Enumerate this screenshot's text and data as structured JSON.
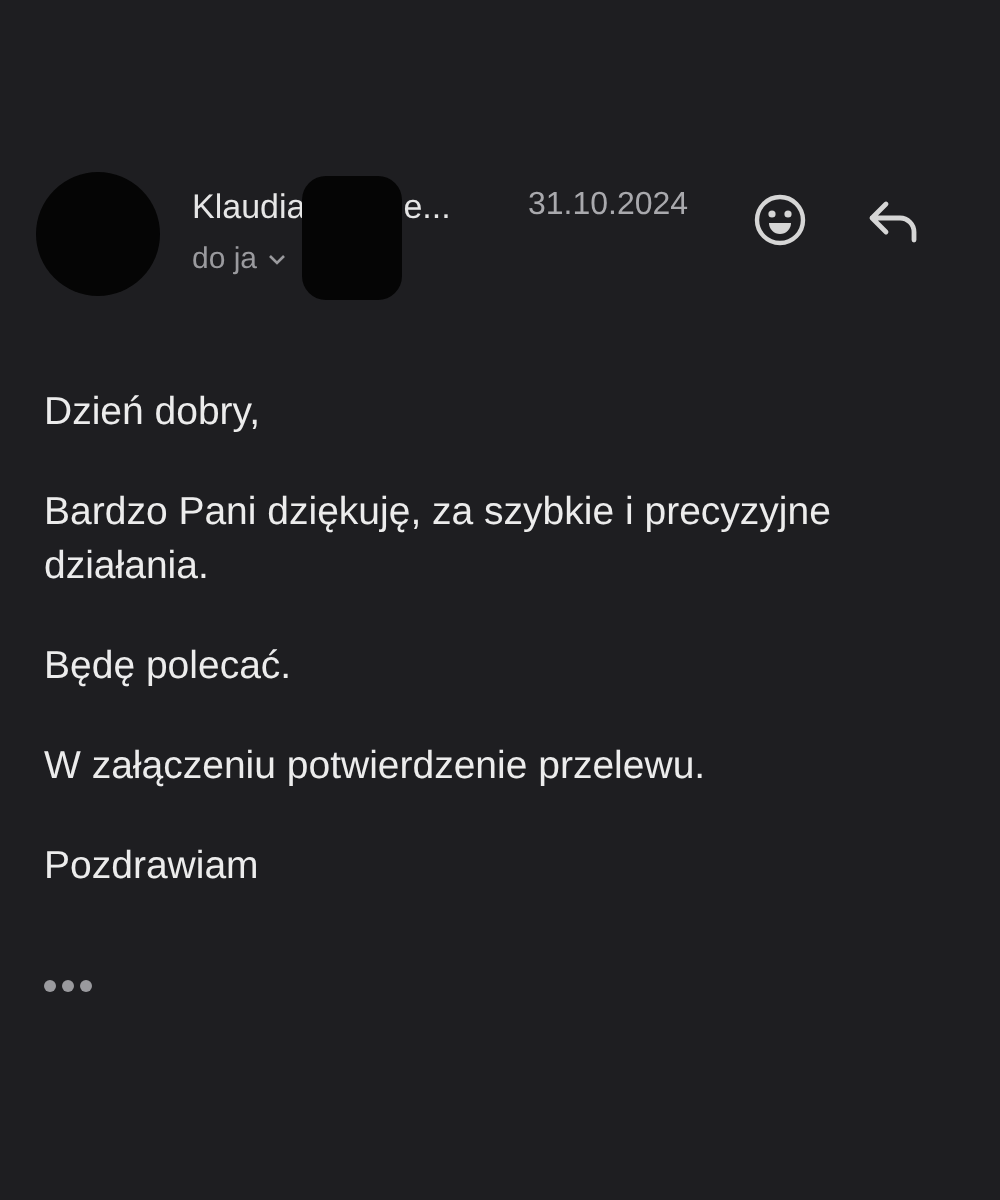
{
  "header": {
    "sender_name": "Klaudia",
    "sender_tail": "e...",
    "date": "31.10.2024",
    "recipient": "do ja"
  },
  "body": {
    "paragraphs": [
      "Dzień dobry,",
      "Bardzo Pani dziękuję, za szybkie i precyzyjne działania.",
      "Będę polecać.",
      "W załączeniu potwierdzenie przelewu.",
      "Pozdrawiam"
    ]
  }
}
